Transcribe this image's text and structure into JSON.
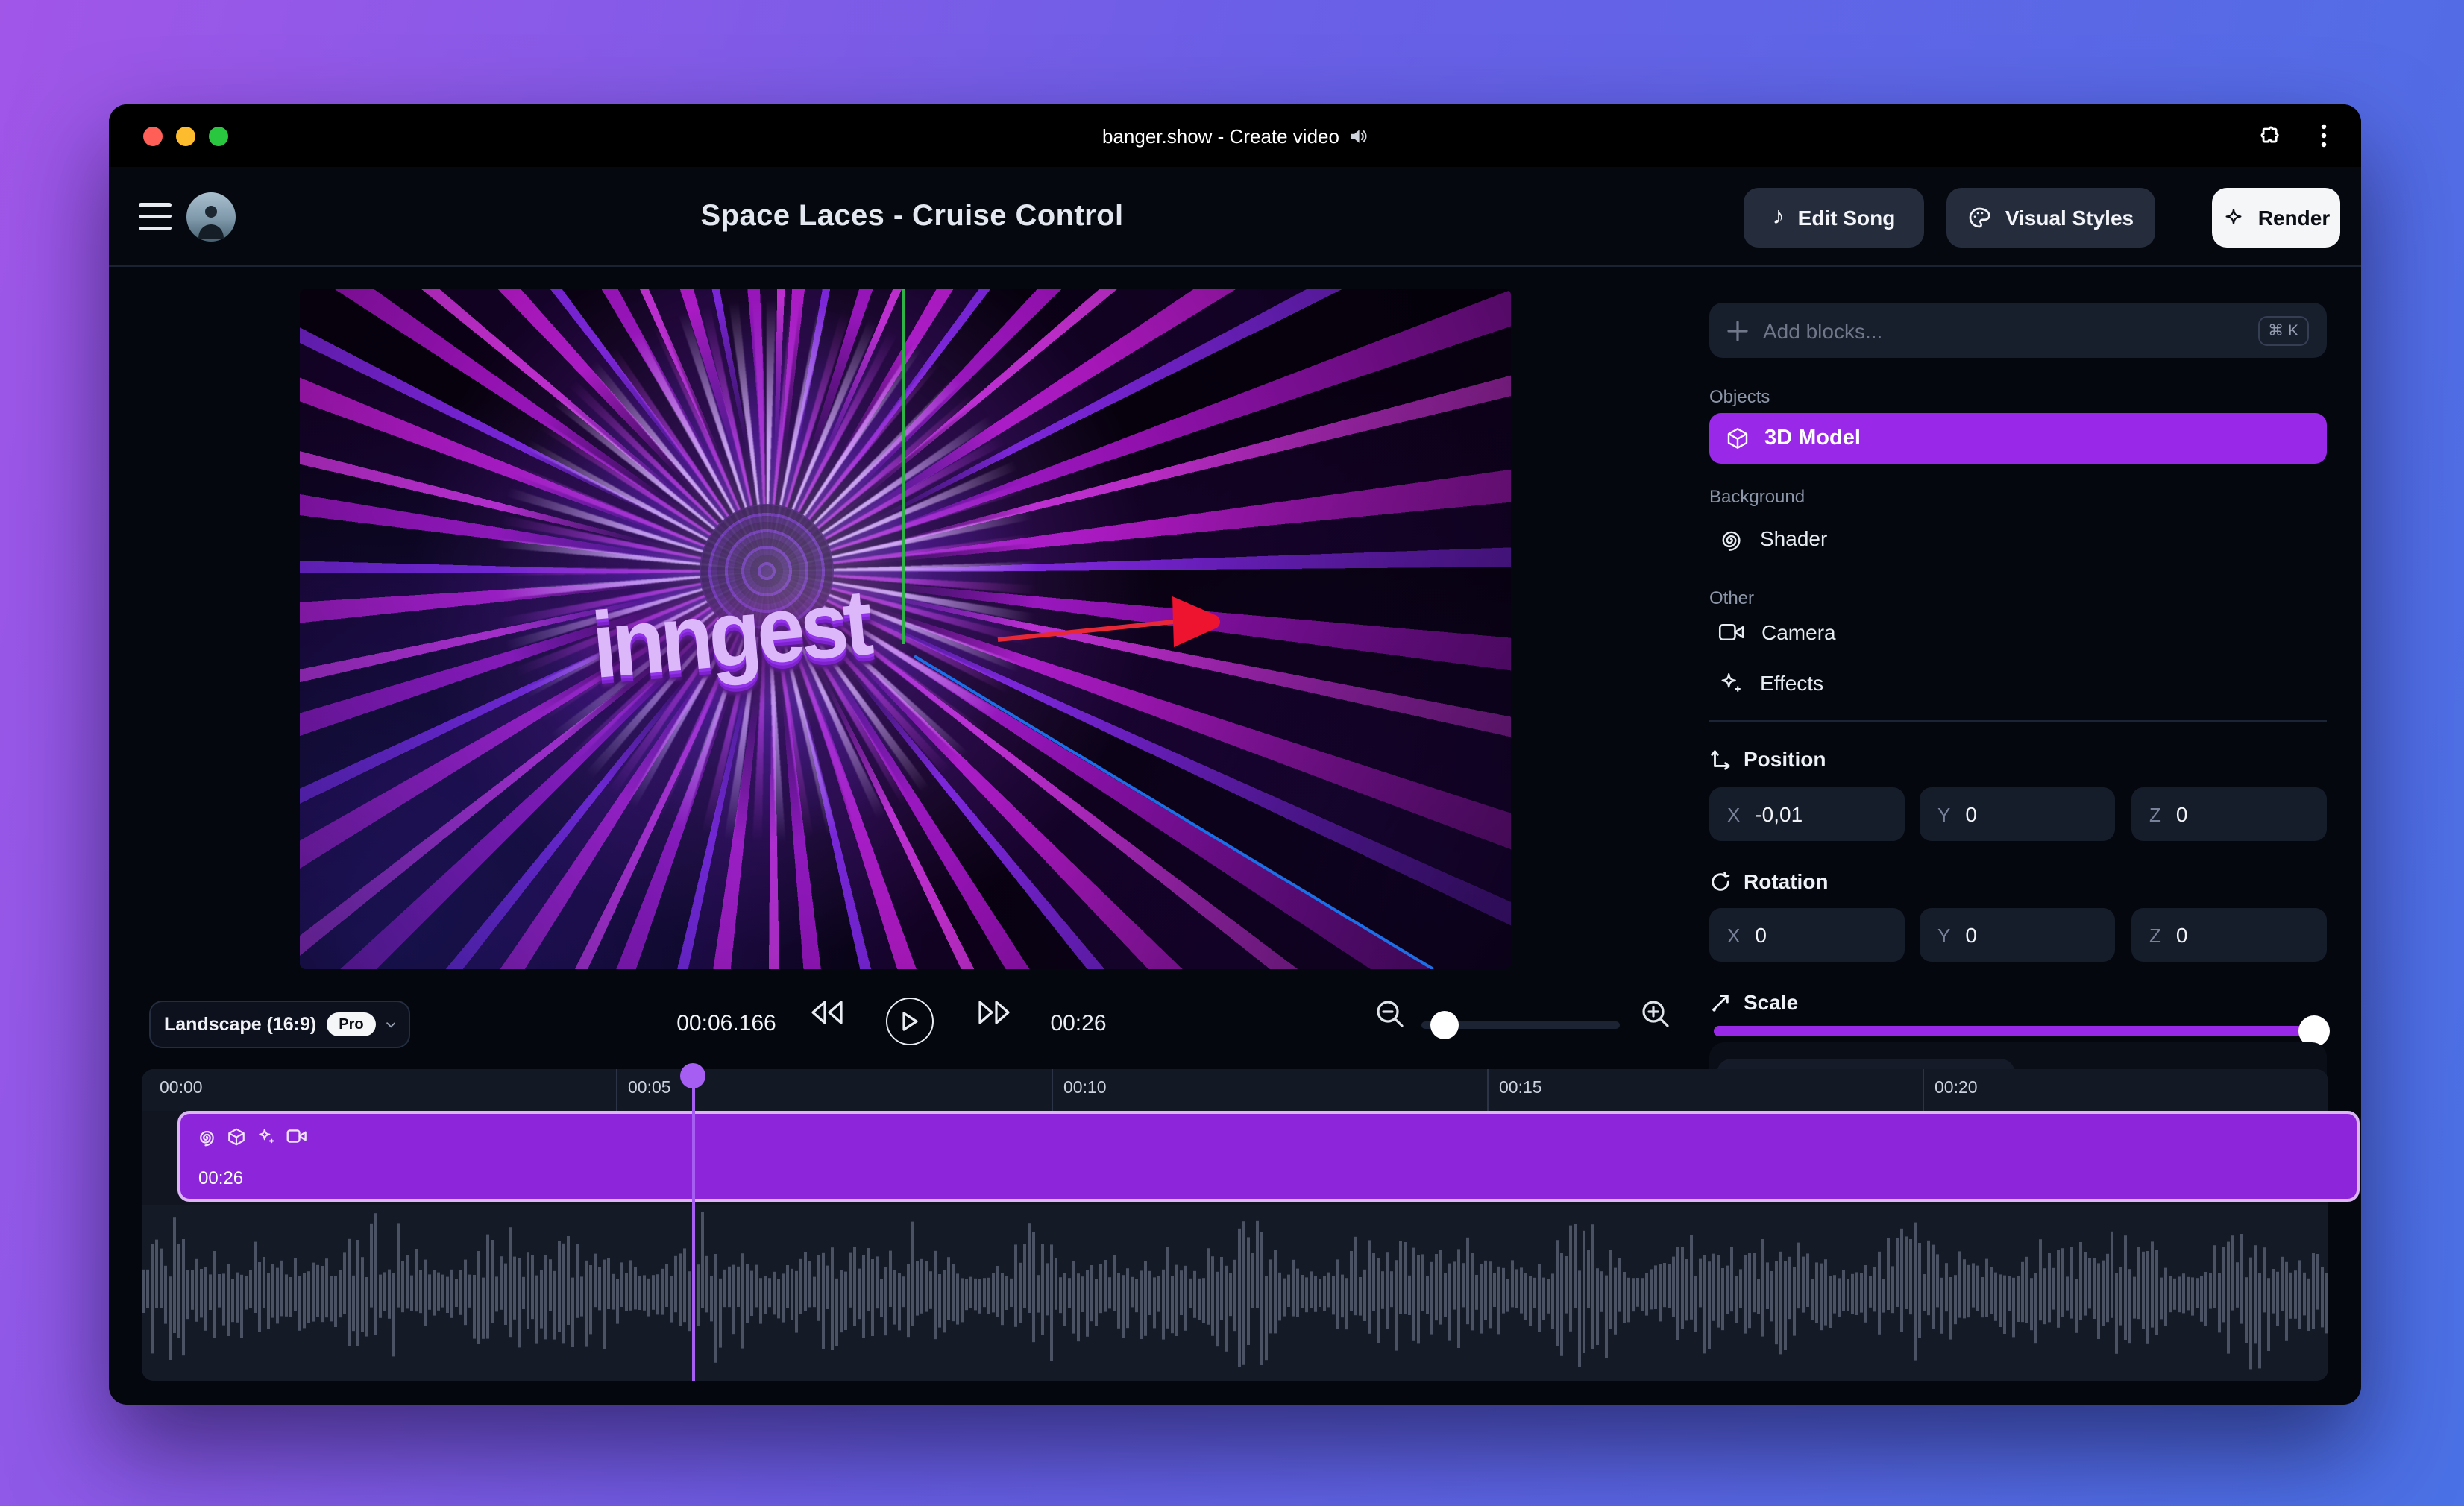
{
  "window": {
    "title": "banger.show - Create video",
    "title_icon": "🔊"
  },
  "header": {
    "project_title": "Space Laces - Cruise Control",
    "edit_song_label": "Edit Song",
    "visual_styles_label": "Visual Styles",
    "render_label": "Render"
  },
  "preview": {
    "video_text": "inngest",
    "aspect_ratio_label": "Landscape (16:9)",
    "pro_badge": "Pro",
    "current_time": "00:06.166",
    "total_duration": "00:26"
  },
  "sidebar": {
    "add_blocks_placeholder": "Add blocks...",
    "add_blocks_shortcut": "⌘ K",
    "objects_label": "Objects",
    "background_label": "Background",
    "other_label": "Other",
    "blocks": {
      "model": "3D Model",
      "shader": "Shader",
      "camera": "Camera",
      "effects": "Effects"
    },
    "transform": {
      "position_label": "Position",
      "rotation_label": "Rotation",
      "scale_label": "Scale",
      "axis_labels": [
        "X",
        "Y",
        "Z"
      ],
      "position_values": [
        "-0,01",
        "0",
        "0"
      ],
      "rotation_values": [
        "0",
        "0",
        "0"
      ],
      "scale_percent": 100
    }
  },
  "timeline": {
    "ruler_labels": [
      "00:00",
      "00:05",
      "00:10",
      "00:15",
      "00:20"
    ],
    "clip_duration_label": "00:26",
    "playhead_seconds": 6.166,
    "total_seconds": 26
  },
  "icons": {
    "music_note_glyph": "♪"
  },
  "colors": {
    "accent_purple": "#9a28e8",
    "clip_fill": "#8d25da",
    "clip_border": "#dcb5f7",
    "playhead": "#a65ef2",
    "waveform": "#4a5263",
    "render_button_bg": "#f5f6f8",
    "desktop_gradient": [
      "#a156e8",
      "#6a5fe7",
      "#4b71e6"
    ],
    "traffic_lights": [
      "#ff5f57",
      "#fdbc2e",
      "#28c73f"
    ]
  }
}
